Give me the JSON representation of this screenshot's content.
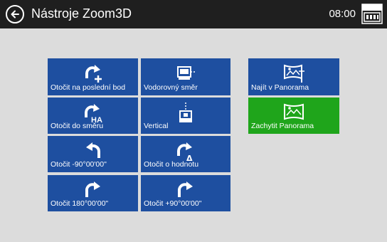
{
  "header": {
    "title": "Nástroje Zoom3D",
    "time": "08:00",
    "icons": {
      "back": "back-arrow-icon",
      "battery": "battery-icon"
    }
  },
  "tiles": {
    "rotate_last_point": {
      "label": "Otočit na poslední bod",
      "icon": "rotate-plus-icon"
    },
    "horizontal_direction": {
      "label": "Vodorovný směr",
      "icon": "horizontal-direction-icon"
    },
    "rotate_to_direction": {
      "label": "Otočit do směru",
      "icon": "rotate-ha-icon",
      "badge": "HA"
    },
    "vertical": {
      "label": "Vertical",
      "icon": "vertical-direction-icon"
    },
    "rotate_minus_90": {
      "label": "Otočit -90°00'00\"",
      "icon": "rotate-left-icon"
    },
    "rotate_by_value": {
      "label": "Otočit o hodnotu",
      "icon": "rotate-delta-icon",
      "badge": "Δ"
    },
    "rotate_180": {
      "label": "Otočit 180°00'00\"",
      "icon": "rotate-right-icon"
    },
    "rotate_plus_90": {
      "label": "Otočit +90°00'00\"",
      "icon": "rotate-right-icon"
    },
    "find_in_panorama": {
      "label": "Najít v Panorama",
      "icon": "panorama-find-icon"
    },
    "capture_panorama": {
      "label": "Zachytit Panorama",
      "icon": "panorama-capture-icon"
    }
  },
  "colors": {
    "titlebar": "#1f1f1f",
    "background": "#dcdcdc",
    "tile_blue": "#1e4fa0",
    "tile_green": "#1fa51b"
  }
}
